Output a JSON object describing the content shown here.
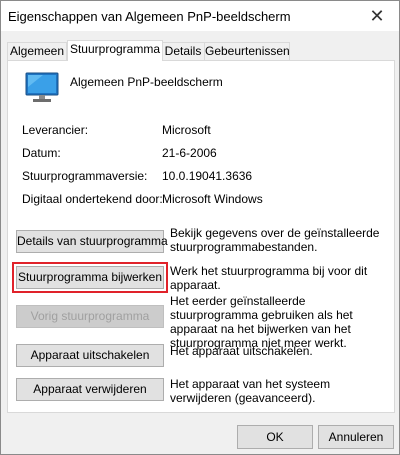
{
  "window": {
    "title": "Eigenschappen van Algemeen PnP-beeldscherm",
    "close_glyph": "✕"
  },
  "tabs": [
    {
      "label": "Algemeen"
    },
    {
      "label": "Stuurprogramma"
    },
    {
      "label": "Details"
    },
    {
      "label": "Gebeurtenissen"
    }
  ],
  "device": {
    "name": "Algemeen PnP-beeldscherm",
    "icon": "monitor-icon"
  },
  "properties": [
    {
      "label": "Leverancier:",
      "value": "Microsoft"
    },
    {
      "label": "Datum:",
      "value": "21-6-2006"
    },
    {
      "label": "Stuurprogrammaversie:",
      "value": "10.0.19041.3636"
    },
    {
      "label": "Digitaal ondertekend door:",
      "value": "Microsoft Windows"
    }
  ],
  "actions": [
    {
      "button": "Details van stuurprogramma",
      "description": "Bekijk gegevens over de geïnstalleerde stuurprogrammabestanden."
    },
    {
      "button": "Stuurprogramma bijwerken",
      "description": "Werk het stuurprogramma bij voor dit apparaat."
    },
    {
      "button": "Vorig stuurprogramma",
      "description": "Het eerder geïnstalleerde stuurprogramma gebruiken als het apparaat na het bijwerken van het stuurprogramma niet meer werkt."
    },
    {
      "button": "Apparaat uitschakelen",
      "description": "Het apparaat uitschakelen."
    },
    {
      "button": "Apparaat verwijderen",
      "description": "Het apparaat van het systeem verwijderen (geavanceerd)."
    }
  ],
  "footer": {
    "ok": "OK",
    "cancel": "Annuleren"
  },
  "colors": {
    "highlight_border": "#e0222a"
  }
}
